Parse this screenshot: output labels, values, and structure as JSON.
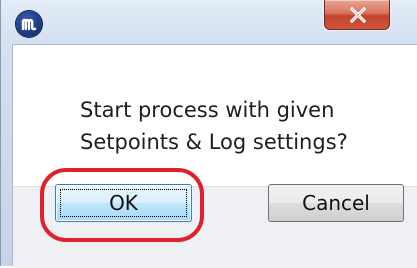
{
  "window": {
    "app_icon": "m-logo-icon",
    "close_icon": "close-icon",
    "close_color": "#c8472f"
  },
  "dialog": {
    "message": "Start process with given\nSetpoints & Log settings?"
  },
  "buttons": {
    "ok_label": "OK",
    "cancel_label": "Cancel"
  },
  "annotation": {
    "highlight_color": "#e0202b",
    "highlight_target": "ok-button"
  }
}
